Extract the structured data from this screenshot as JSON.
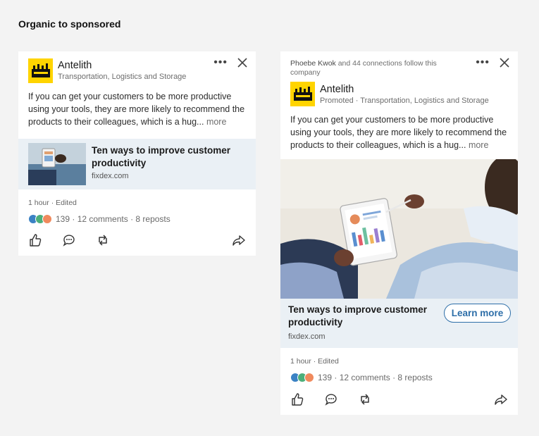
{
  "heading": "Organic to sponsored",
  "organic": {
    "company_name": "Antelith",
    "company_subtitle": "Transportation, Logistics and Storage",
    "post_text": "If you can get your customers to be more productive using your tools, they are more likely to recommend the products to their colleagues, which is a hug...",
    "more_label": "more",
    "link_title": "Ten ways to improve customer productivity",
    "link_domain": "fixdex.com",
    "meta": "1 hour · Edited",
    "reaction_count": "139",
    "comments": "· 12 comments",
    "reposts": "· 8 reposts"
  },
  "sponsored": {
    "social_name": "Phoebe Kwok",
    "social_rest": "and 44 connections follow this company",
    "company_name": "Antelith",
    "company_subtitle": "Promoted · Transportation, Logistics and Storage",
    "post_text": "If you can get your customers to be more productive using your tools, they are more likely to recommend the products to their colleagues, which is a hug...",
    "more_label": "more",
    "link_title": "Ten ways to improve customer productivity",
    "link_domain": "fixdex.com",
    "cta_label": "Learn more",
    "meta": "1 hour · Edited",
    "reaction_count": "139",
    "comments": "· 12 comments",
    "reposts": "· 8 reposts"
  },
  "icons": {
    "more": "more-horizontal-icon",
    "close": "close-icon",
    "like": "thumbs-up-icon",
    "comment": "comment-icon",
    "repost": "repost-icon",
    "share": "share-icon"
  },
  "colors": {
    "logo_yellow": "#ffd400",
    "link_block_bg": "#eaf0f5",
    "cta_blue": "#2d6ea8",
    "reaction_like": "#3b82c4",
    "reaction_celebrate": "#4caf7a",
    "reaction_love": "#f08a5d"
  }
}
